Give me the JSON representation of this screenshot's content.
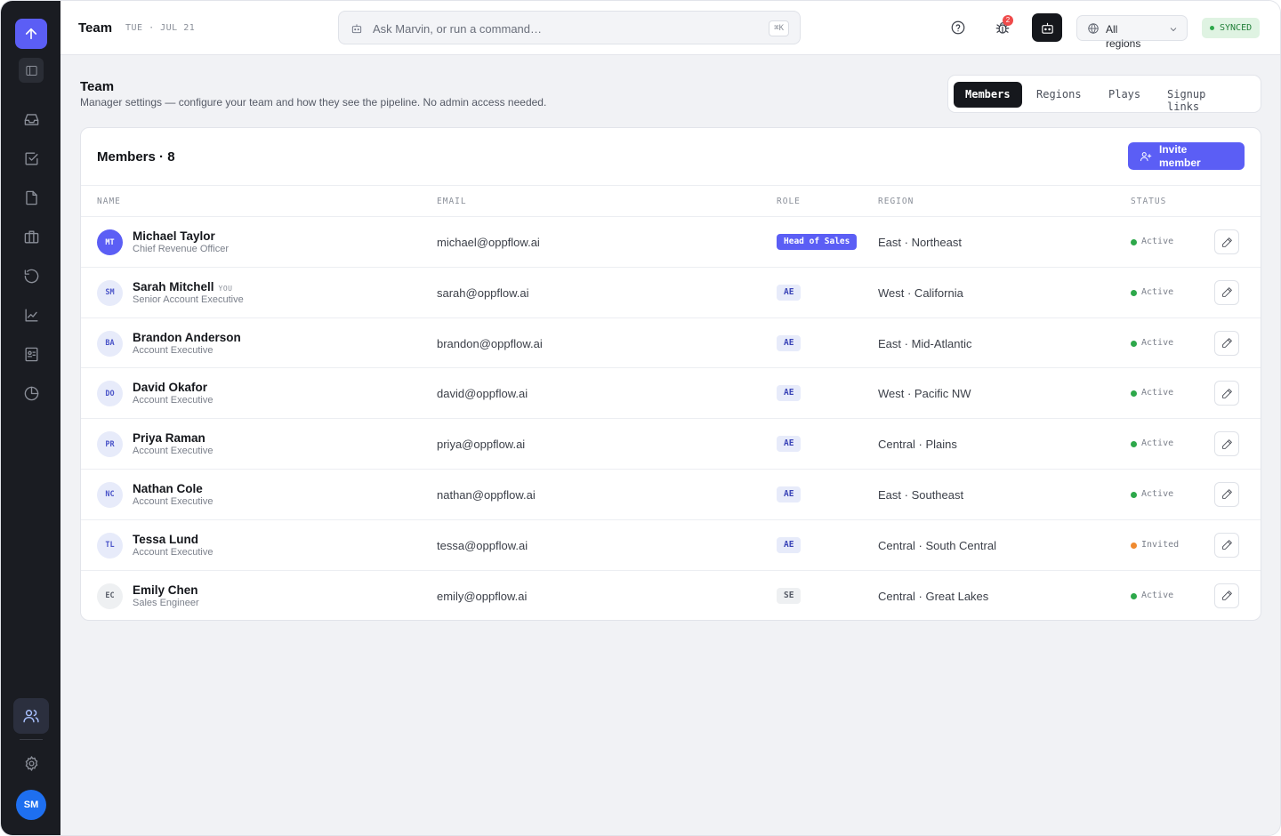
{
  "sidebar": {
    "logo_icon": "arrow-up-icon",
    "nav": [
      {
        "icon": "inbox-icon"
      },
      {
        "icon": "checklist-icon"
      },
      {
        "icon": "document-icon"
      },
      {
        "icon": "briefcase-icon"
      },
      {
        "icon": "history-icon"
      },
      {
        "icon": "trend-chart-icon"
      },
      {
        "icon": "contact-card-icon"
      },
      {
        "icon": "pie-chart-icon"
      }
    ],
    "active_icon": "team-icon",
    "settings_icon": "gear-icon",
    "user_initials": "SM"
  },
  "header": {
    "title": "Team",
    "date": "TUE · JUL 21",
    "search_placeholder": "Ask Marvin, or run a command…",
    "search_shortcut": "⌘K",
    "notification_count": "2",
    "region_select": "All regions",
    "sync_status": "SYNCED"
  },
  "page": {
    "title": "Team",
    "subtitle": "Manager settings — configure your team and how they see the pipeline. No admin access needed.",
    "tabs": [
      {
        "label": "Members",
        "active": true
      },
      {
        "label": "Regions",
        "active": false
      },
      {
        "label": "Plays",
        "active": false
      },
      {
        "label": "Signup links",
        "active": false
      }
    ]
  },
  "members": {
    "title": "Members · 8",
    "invite_label": "Invite member",
    "columns": [
      "NAME",
      "EMAIL",
      "ROLE",
      "REGION",
      "STATUS"
    ],
    "rows": [
      {
        "initials": "MT",
        "name": "Michael Taylor",
        "you": "",
        "title": "Chief Revenue Officer",
        "email": "michael@oppflow.ai",
        "role": "Head of Sales",
        "role_style": "primary",
        "region": "East · Northeast",
        "status": "Active",
        "status_color": "#2da84a"
      },
      {
        "initials": "SM",
        "name": "Sarah Mitchell",
        "you": "YOU",
        "title": "Senior Account Executive",
        "email": "sarah@oppflow.ai",
        "role": "AE",
        "role_style": "default",
        "region": "West · California",
        "status": "Active",
        "status_color": "#2da84a"
      },
      {
        "initials": "BA",
        "name": "Brandon Anderson",
        "you": "",
        "title": "Account Executive",
        "email": "brandon@oppflow.ai",
        "role": "AE",
        "role_style": "default",
        "region": "East · Mid-Atlantic",
        "status": "Active",
        "status_color": "#2da84a"
      },
      {
        "initials": "DO",
        "name": "David Okafor",
        "you": "",
        "title": "Account Executive",
        "email": "david@oppflow.ai",
        "role": "AE",
        "role_style": "default",
        "region": "West · Pacific NW",
        "status": "Active",
        "status_color": "#2da84a"
      },
      {
        "initials": "PR",
        "name": "Priya Raman",
        "you": "",
        "title": "Account Executive",
        "email": "priya@oppflow.ai",
        "role": "AE",
        "role_style": "default",
        "region": "Central · Plains",
        "status": "Active",
        "status_color": "#2da84a"
      },
      {
        "initials": "NC",
        "name": "Nathan Cole",
        "you": "",
        "title": "Account Executive",
        "email": "nathan@oppflow.ai",
        "role": "AE",
        "role_style": "default",
        "region": "East · Southeast",
        "status": "Active",
        "status_color": "#2da84a"
      },
      {
        "initials": "TL",
        "name": "Tessa Lund",
        "you": "",
        "title": "Account Executive",
        "email": "tessa@oppflow.ai",
        "role": "AE",
        "role_style": "default",
        "region": "Central · South Central",
        "status": "Invited",
        "status_color": "#ef8a2f"
      },
      {
        "initials": "EC",
        "name": "Emily Chen",
        "you": "",
        "title": "Sales Engineer",
        "email": "emily@oppflow.ai",
        "role": "SE",
        "role_style": "gray",
        "region": "Central · Great Lakes",
        "status": "Active",
        "status_color": "#2da84a"
      }
    ]
  },
  "colors": {
    "accent": "#5b5ef5",
    "sidebar": "#1a1c22",
    "active_status": "#2da84a",
    "invited_status": "#ef8a2f"
  }
}
